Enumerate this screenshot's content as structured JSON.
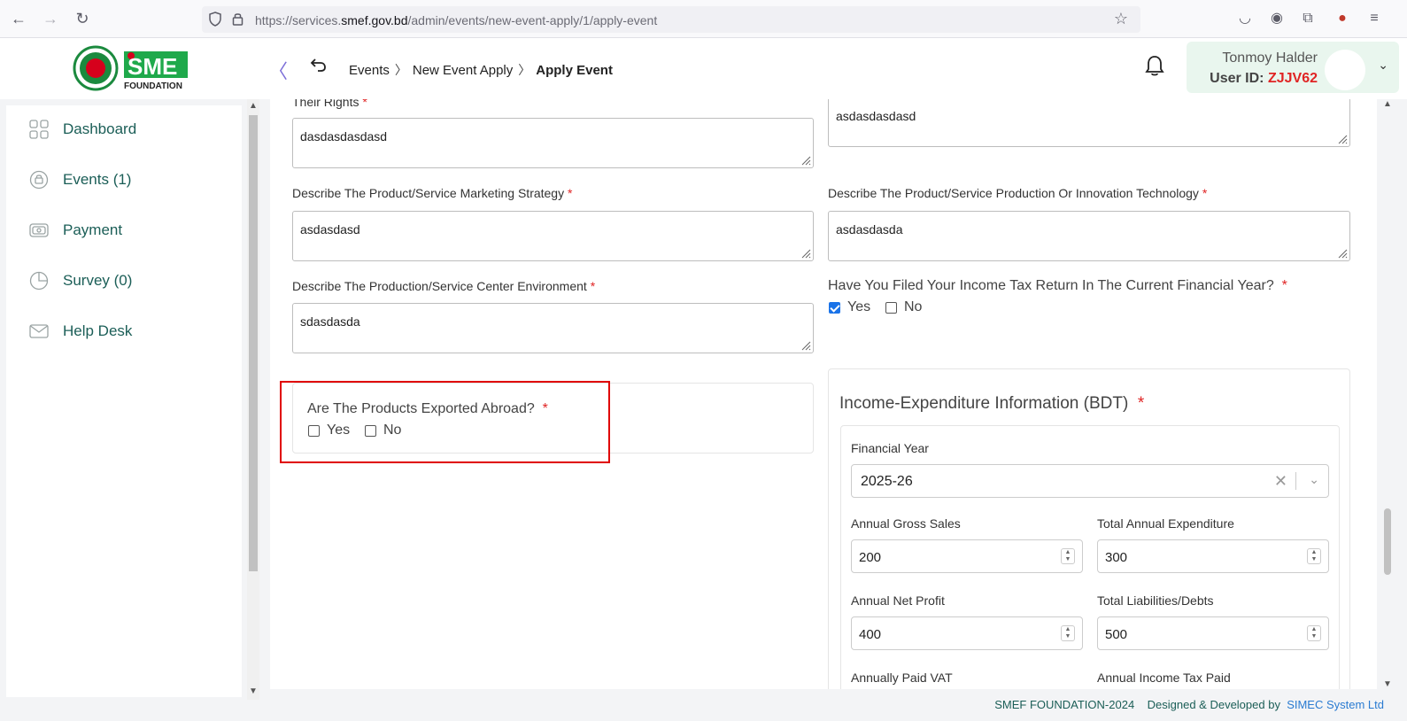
{
  "browser": {
    "url_prefix": "https://services.",
    "url_host": "smef.gov.bd",
    "url_path": "/admin/events/new-event-apply/1/apply-event"
  },
  "logo": {
    "brand": "SME",
    "sub": "FOUNDATION"
  },
  "breadcrumb": {
    "items": [
      "Events",
      "New Event Apply"
    ],
    "current": "Apply Event"
  },
  "user": {
    "name": "Tonmoy Halder",
    "id_label": "User ID:",
    "id_value": "ZJJV62"
  },
  "sidebar": {
    "items": [
      {
        "label": "Dashboard",
        "icon": "grid-icon"
      },
      {
        "label": "Events (1)",
        "icon": "events-icon"
      },
      {
        "label": "Payment",
        "icon": "payment-icon"
      },
      {
        "label": "Survey (0)",
        "icon": "pie-chart-icon"
      },
      {
        "label": "Help Desk",
        "icon": "mail-icon"
      }
    ]
  },
  "form": {
    "rights_label": "Their Rights",
    "rights_value": "dasdasdasdasd",
    "top_right_value": "asdasdasdasd",
    "marketing_label": "Describe The Product/Service Marketing Strategy",
    "marketing_value": "asdasdasd",
    "production_tech_label": "Describe The Product/Service Production Or Innovation Technology",
    "production_tech_value": "asdasdasda",
    "environment_label": "Describe The Production/Service Center Environment",
    "environment_value": "sdasdasda",
    "tax_question": "Have You Filed Your Income Tax Return In The Current Financial Year?",
    "export_question": "Are The Products Exported Abroad?",
    "yes": "Yes",
    "no": "No",
    "required_mark": "*"
  },
  "income": {
    "title": "Income-Expenditure Information (BDT)",
    "financial_year_label": "Financial Year",
    "financial_year_value": "2025-26",
    "gross_sales_label": "Annual Gross Sales",
    "gross_sales_value": "200",
    "expenditure_label": "Total Annual Expenditure",
    "expenditure_value": "300",
    "net_profit_label": "Annual Net Profit",
    "net_profit_value": "400",
    "liabilities_label": "Total Liabilities/Debts",
    "liabilities_value": "500",
    "vat_label": "Annually Paid VAT",
    "income_tax_label": "Annual Income Tax Paid"
  },
  "footer": {
    "copyright": "SMEF FOUNDATION-2024",
    "designed_by": "Designed & Developed by",
    "company": "SIMEC System Ltd"
  },
  "colors": {
    "accent_green": "#1b5e57",
    "required_red": "#e02424",
    "highlight_red": "#e00000",
    "checkbox_blue": "#1a73e8"
  }
}
